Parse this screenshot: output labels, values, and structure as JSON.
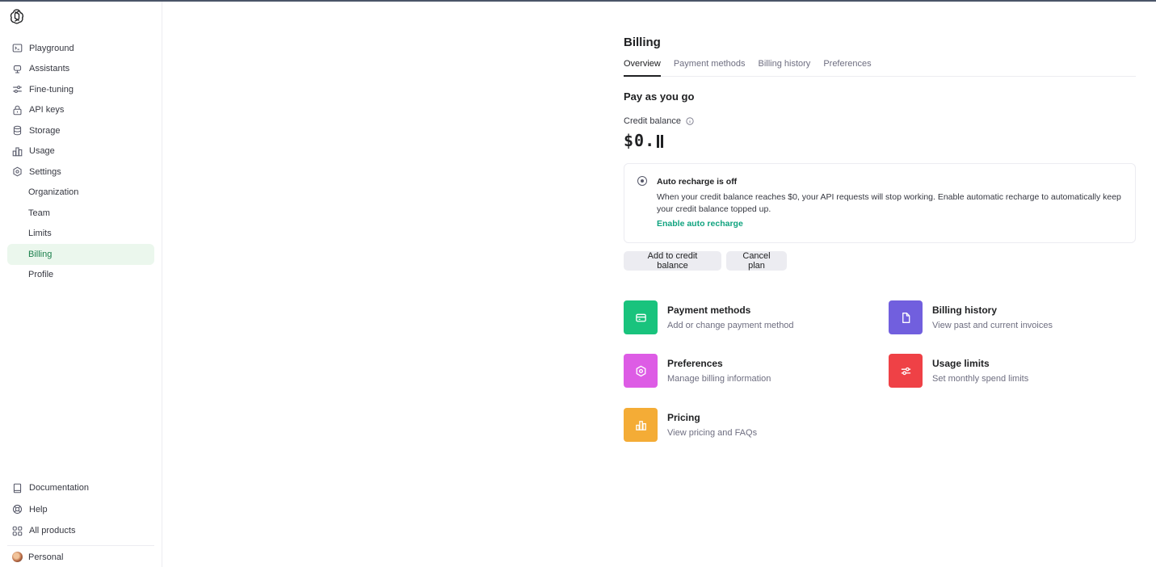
{
  "sidebar": {
    "items": [
      {
        "label": "Playground",
        "icon": "terminal-icon"
      },
      {
        "label": "Assistants",
        "icon": "robot-icon"
      },
      {
        "label": "Fine-tuning",
        "icon": "sliders-icon"
      },
      {
        "label": "API keys",
        "icon": "lock-icon"
      },
      {
        "label": "Storage",
        "icon": "database-icon"
      },
      {
        "label": "Usage",
        "icon": "bar-chart-icon"
      },
      {
        "label": "Settings",
        "icon": "gear-icon"
      }
    ],
    "settings_sub": [
      "Organization",
      "Team",
      "Limits",
      "Billing",
      "Profile"
    ],
    "active_item": "Billing",
    "bottom": [
      {
        "label": "Documentation",
        "icon": "book-icon"
      },
      {
        "label": "Help",
        "icon": "lifebuoy-icon"
      },
      {
        "label": "All products",
        "icon": "grid-icon"
      }
    ],
    "personal": "Personal"
  },
  "billing": {
    "title": "Billing",
    "tabs": [
      "Overview",
      "Payment methods",
      "Billing history",
      "Preferences"
    ],
    "active_tab": "Overview",
    "section_title": "Pay as you go",
    "credit_label": "Credit balance",
    "credit_value": "$0.",
    "recharge": {
      "title": "Auto recharge is off",
      "text": "When your credit balance reaches $0, your API requests will stop working. Enable automatic recharge to automatically keep your credit balance topped up.",
      "link": "Enable auto recharge"
    },
    "buttons": {
      "add": "Add to credit balance",
      "cancel": "Cancel plan"
    },
    "cards": [
      {
        "title": "Payment methods",
        "desc": "Add or change payment method",
        "color": "#19c37d",
        "icon": "credit-card-icon"
      },
      {
        "title": "Billing history",
        "desc": "View past and current invoices",
        "color": "#715fde",
        "icon": "document-icon"
      },
      {
        "title": "Preferences",
        "desc": "Manage billing information",
        "color": "#dd5ce5",
        "icon": "gear-icon"
      },
      {
        "title": "Usage limits",
        "desc": "Set monthly spend limits",
        "color": "#ef4146",
        "icon": "sliders-icon"
      },
      {
        "title": "Pricing",
        "desc": "View pricing and FAQs",
        "color": "#f4ac36",
        "icon": "bar-chart-icon"
      }
    ]
  },
  "colors": {
    "accent_green": "#10a37f",
    "active_bg": "#ebf7ed"
  }
}
